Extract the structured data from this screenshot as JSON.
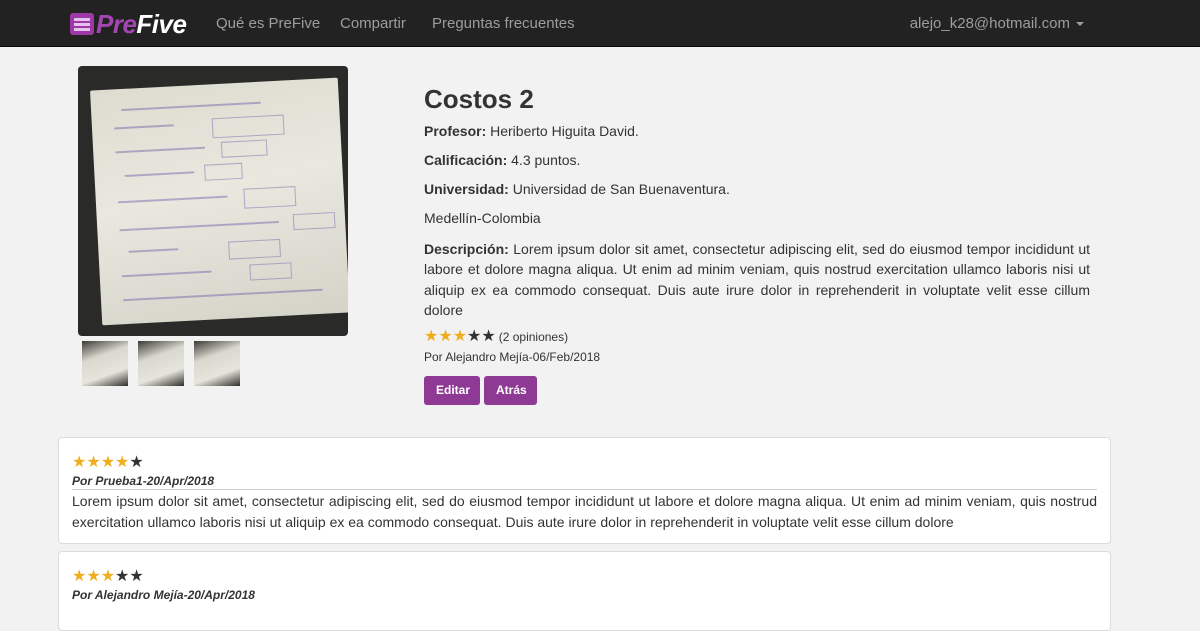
{
  "navbar": {
    "brand_pre": "Pre",
    "brand_five": "Five",
    "links": [
      "Qué es PreFive",
      "Compartir",
      "Preguntas frecuentes"
    ],
    "user_email": "alejo_k28@hotmail.com"
  },
  "course": {
    "title": "Costos 2",
    "profesor_label": "Profesor:",
    "profesor": "Heriberto Higuita David.",
    "calificacion_label": "Calificación:",
    "calificacion": "4.3 puntos.",
    "universidad_label": "Universidad:",
    "universidad": "Universidad de San Buenaventura.",
    "ciudad": "Medellín-Colombia",
    "descripcion_label": "Descripción:",
    "descripcion": "Lorem ipsum dolor sit amet, consectetur adipiscing elit, sed do eiusmod tempor incididunt ut labore et dolore magna aliqua. Ut enim ad minim veniam, quis nostrud exercitation ullamco laboris nisi ut aliquip ex ea commodo consequat. Duis aute irure dolor in reprehenderit in voluptate velit esse cillum dolore",
    "rating_stars": 3,
    "rating_max": 5,
    "rating_count": "(2 opiniones)",
    "byline": "Por Alejandro Mejía-06/Feb/2018"
  },
  "buttons": {
    "edit": "Editar",
    "back": "Atrás"
  },
  "reviews": [
    {
      "stars": 4,
      "author": "Por Prueba1-20/Apr/2018",
      "text": "Lorem ipsum dolor sit amet, consectetur adipiscing elit, sed do eiusmod tempor incididunt ut labore et dolore magna aliqua. Ut enim ad minim veniam, quis nostrud exercitation ullamco laboris nisi ut aliquip ex ea commodo consequat. Duis aute irure dolor in reprehenderit in voluptate velit esse cillum dolore"
    },
    {
      "stars": 3,
      "author": "Por Alejandro Mejía-20/Apr/2018",
      "text": ""
    }
  ],
  "colors": {
    "navbar_bg": "#222222",
    "brand": "#a247b1",
    "button": "#8e3a95",
    "star_on": "#f0ad1e",
    "star_off": "#333333"
  }
}
